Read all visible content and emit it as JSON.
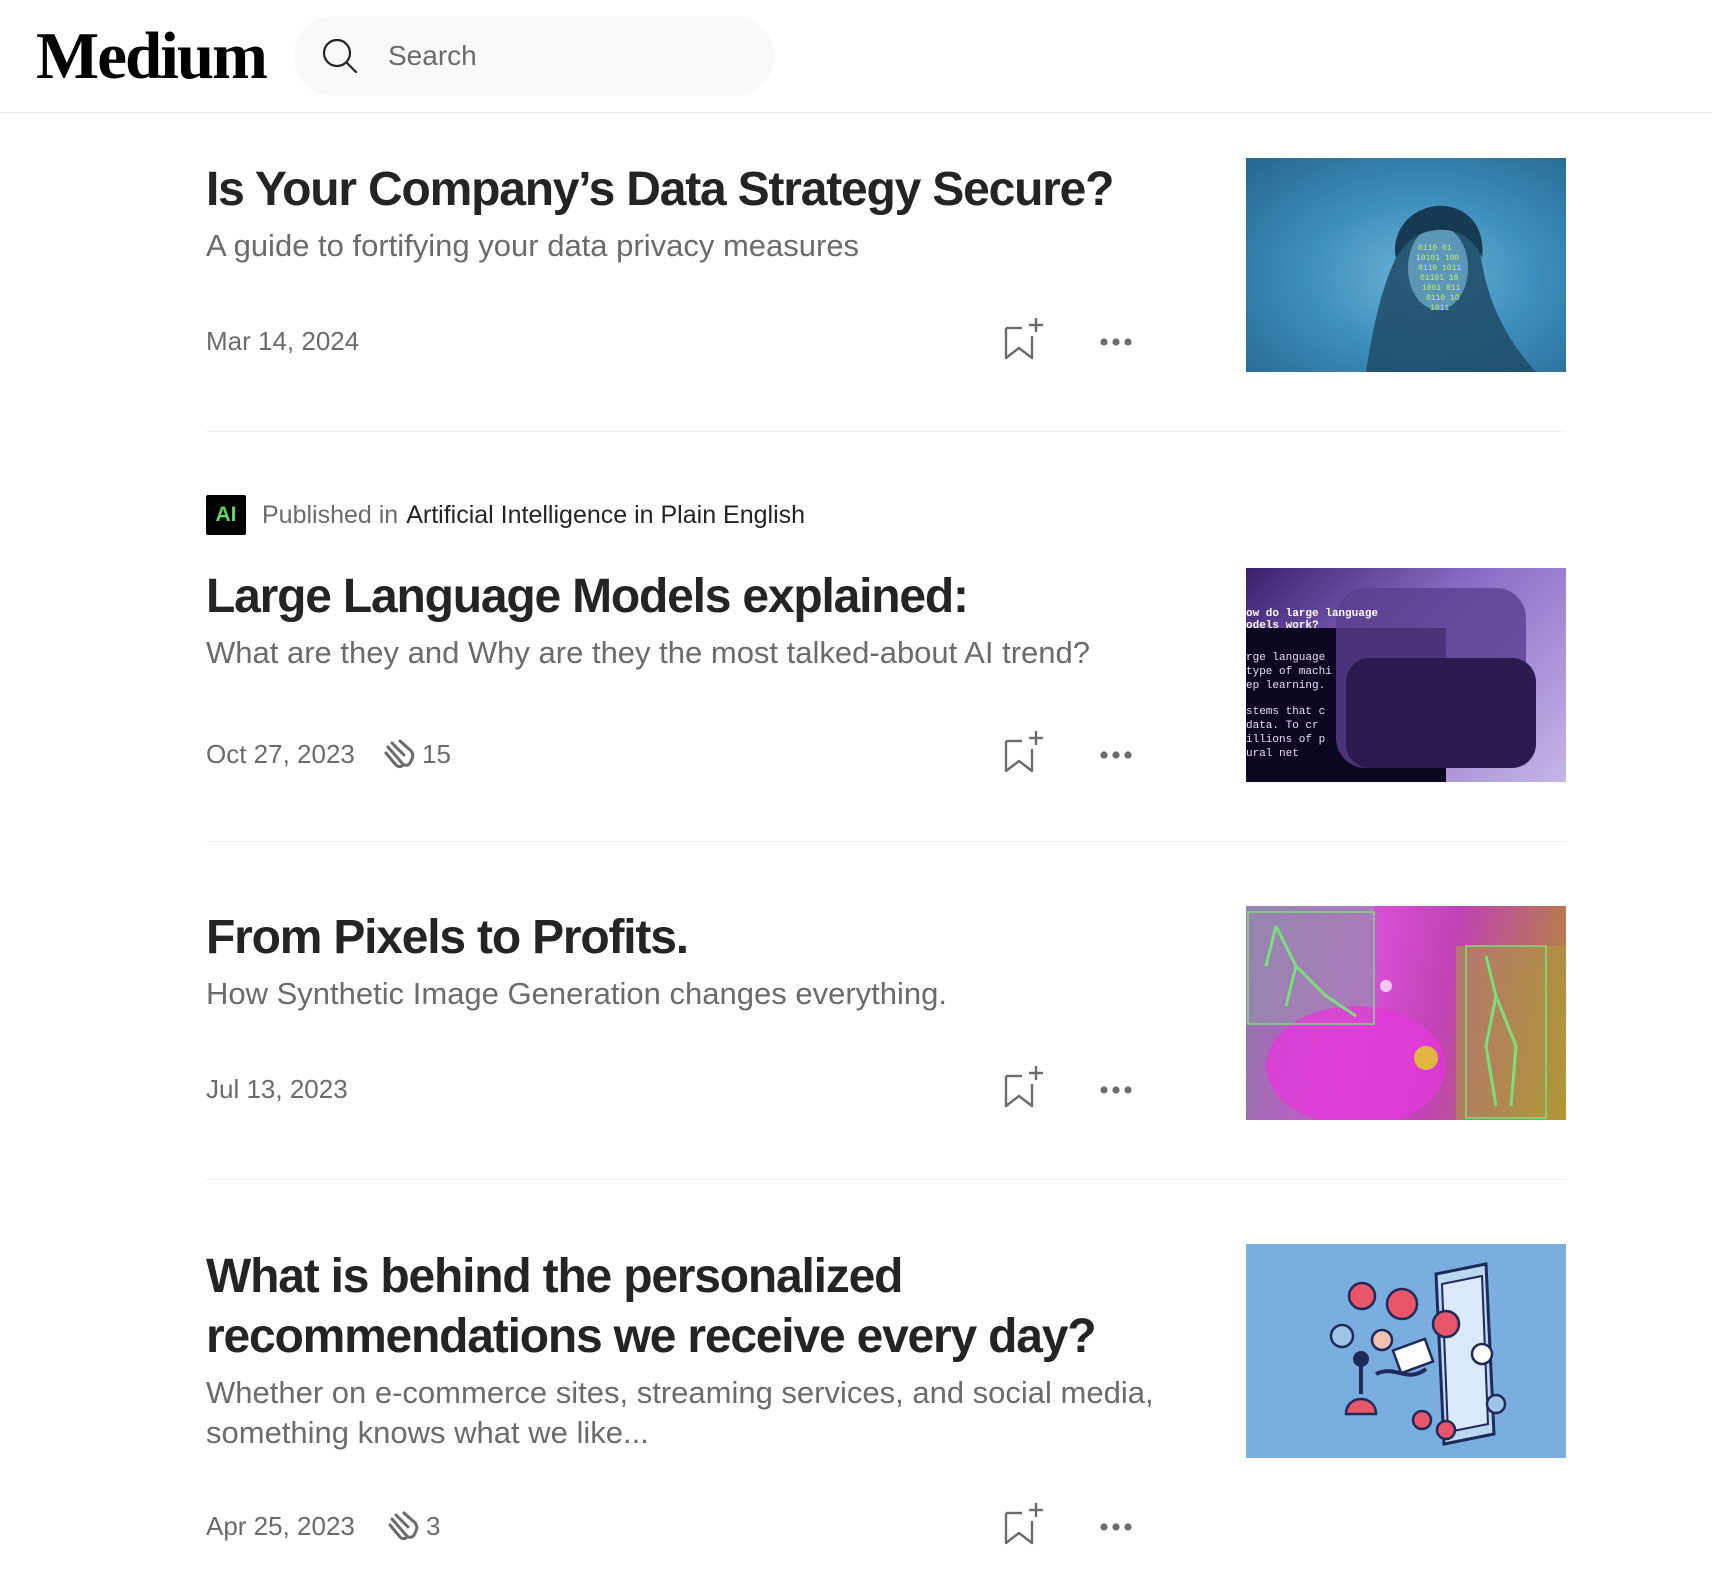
{
  "header": {
    "logo": "Medium",
    "search_placeholder": "Search"
  },
  "articles": [
    {
      "title": "Is Your Company’s Data Strategy Secure?",
      "subtitle": "A guide to fortifying your data privacy measures",
      "date": "Mar 14, 2024",
      "claps": null,
      "thumbnail": "woman-with-binary-code-projection"
    },
    {
      "publication_prefix": "Published in",
      "publication_name": "Artificial Intelligence in Plain English",
      "publication_logo": "AI",
      "title": "Large Language Models explained:",
      "subtitle": "What are they and Why are they the most talked-about AI trend?",
      "date": "Oct 27, 2023",
      "claps": "15",
      "thumbnail": "llm-terminal-screen"
    },
    {
      "title": "From Pixels to Profits.",
      "subtitle": "How Synthetic Image Generation changes everything.",
      "date": "Jul 13, 2023",
      "claps": null,
      "thumbnail": "synthetic-pose-detection"
    },
    {
      "title": "What is behind the personalized recommendations we receive every day?",
      "subtitle": "Whether on e-commerce sites, streaming services, and social media, something knows what we like...",
      "date": "Apr 25, 2023",
      "claps": "3",
      "thumbnail": "isometric-recommendation-machine"
    }
  ],
  "icons": {
    "search": "search-icon",
    "clap": "clap-icon",
    "bookmark": "bookmark-add-icon",
    "more": "more-horizontal-icon"
  },
  "colors": {
    "text": "#242424",
    "muted": "#6b6b6b",
    "search_bg": "#f9f9f9",
    "publication_accent": "#5cd65c"
  }
}
